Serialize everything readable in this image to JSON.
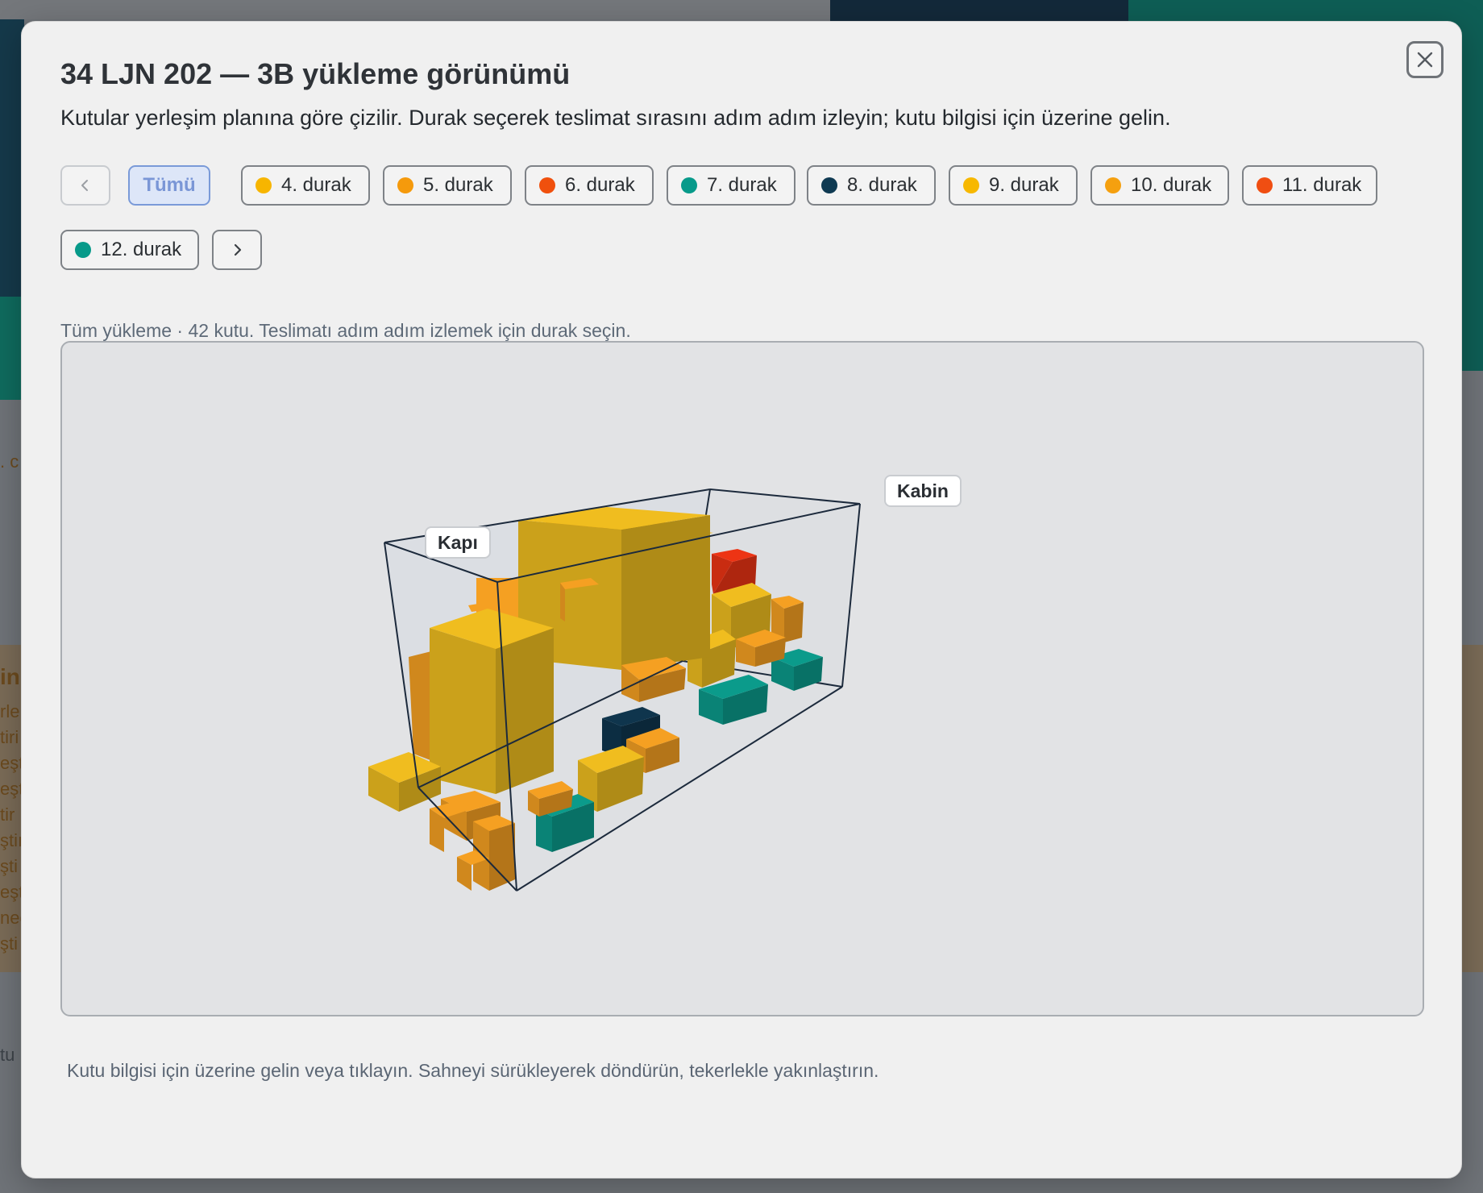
{
  "modal": {
    "title": "34 LJN 202 — 3B yükleme görünümü",
    "subtitle": "Kutular yerleşim planına göre çizilir. Durak seçerek teslimat sırasını adım adım izleyin; kutu bilgisi için üzerine gelin.",
    "close_icon": "close-icon"
  },
  "stops": {
    "prev_icon": "chevron-left-icon",
    "next_icon": "chevron-right-icon",
    "all_label": "Tümü",
    "items": [
      {
        "label": "4. durak",
        "color": "#f7b500"
      },
      {
        "label": "5. durak",
        "color": "#f59a0c"
      },
      {
        "label": "6. durak",
        "color": "#f0500d"
      },
      {
        "label": "7. durak",
        "color": "#079a8a"
      },
      {
        "label": "8. durak",
        "color": "#0f3a52"
      },
      {
        "label": "9. durak",
        "color": "#f7b800"
      },
      {
        "label": "10. durak",
        "color": "#f5a00f"
      },
      {
        "label": "11. durak",
        "color": "#f04e12"
      },
      {
        "label": "12. durak",
        "color": "#079a8a"
      }
    ]
  },
  "summary": "Tüm yükleme · 42 kutu. Teslimatı adım adım izlemek için durak seçin.",
  "scene": {
    "door_label": "Kapı",
    "cabin_label": "Kabin",
    "box_colors": {
      "yellow": "#d6a91c",
      "orange": "#db8f1e",
      "red": "#d42e12",
      "teal": "#0a8a7c",
      "navy": "#0d2f45"
    }
  },
  "hint": "Kutu bilgisi için üzerine gelin veya tıklayın. Sahneyi sürükleyerek döndürün, tekerlekle yakınlaştırın.",
  "background": {
    "side_text": [
      ". c",
      "in",
      "rle",
      "tiri",
      "eşt",
      "eşt",
      "tir",
      "ştiı",
      "şti",
      "eşt",
      "neç",
      "şti",
      "tu"
    ]
  }
}
